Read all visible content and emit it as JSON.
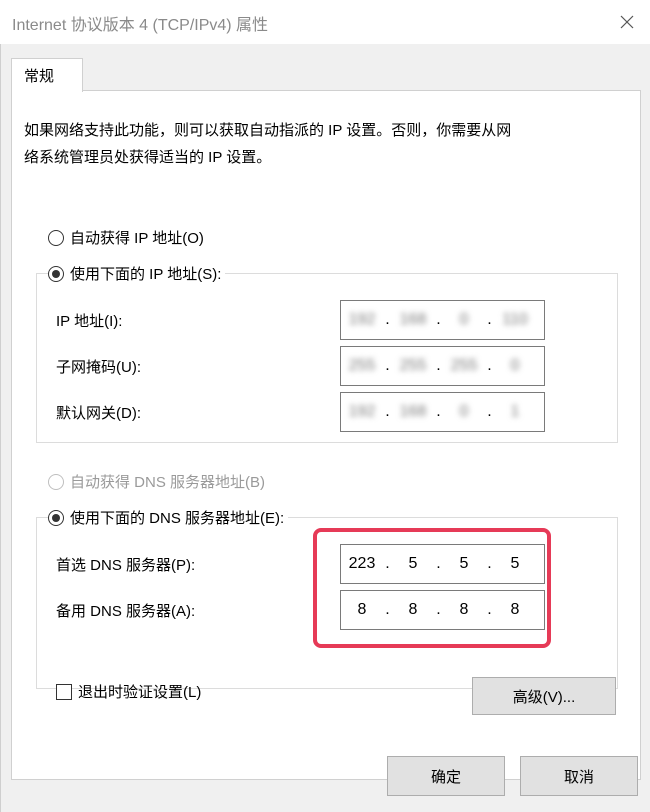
{
  "window": {
    "title": "Internet 协议版本 4 (TCP/IPv4) 属性"
  },
  "tabs": [
    {
      "label": "常规"
    }
  ],
  "description": {
    "line1": "如果网络支持此功能，则可以获取自动指派的 IP 设置。否则，你需要从网",
    "line2": "络系统管理员处获得适当的 IP 设置。"
  },
  "ip_section": {
    "auto_option": "自动获得 IP 地址(O)",
    "manual_option": "使用下面的 IP 地址(S):",
    "selected": "manual",
    "fields": [
      {
        "label": "IP 地址(I):",
        "octets": [
          "192",
          "168",
          "0",
          "110"
        ]
      },
      {
        "label": "子网掩码(U):",
        "octets": [
          "255",
          "255",
          "255",
          "0"
        ]
      },
      {
        "label": "默认网关(D):",
        "octets": [
          "192",
          "168",
          "0",
          "1"
        ]
      }
    ]
  },
  "dns_section": {
    "auto_option": "自动获得 DNS 服务器地址(B)",
    "manual_option": "使用下面的 DNS 服务器地址(E):",
    "selected": "manual",
    "preferred": {
      "label": "首选 DNS 服务器(P):",
      "octets": [
        "223",
        "5",
        "5",
        "5"
      ]
    },
    "alternate": {
      "label": "备用 DNS 服务器(A):",
      "octets": [
        "8",
        "8",
        "8",
        "8"
      ]
    }
  },
  "validate_checkbox": {
    "label": "退出时验证设置(L)",
    "checked": false
  },
  "buttons": {
    "advanced": "高级(V)...",
    "ok": "确定",
    "cancel": "取消"
  },
  "colors": {
    "highlight": "#e63a57",
    "client_bg": "#f0f0f0",
    "button_bg": "#e1e1e1"
  }
}
